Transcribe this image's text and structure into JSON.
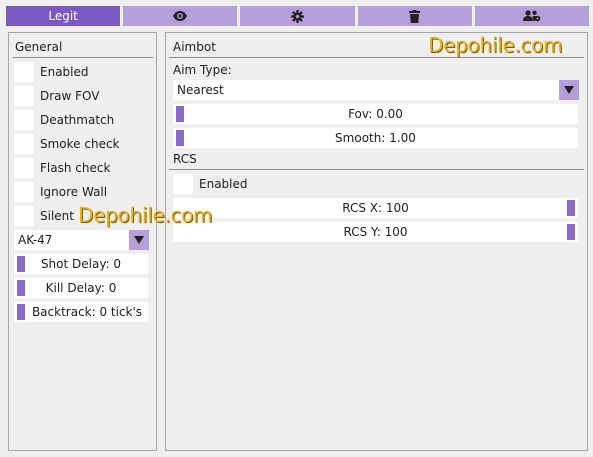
{
  "tabs": [
    {
      "label": "Legit",
      "icon": "",
      "active": true
    },
    {
      "label": "",
      "icon": "eye-icon",
      "active": false
    },
    {
      "label": "",
      "icon": "gear-icon",
      "active": false
    },
    {
      "label": "",
      "icon": "trash-icon",
      "active": false
    },
    {
      "label": "",
      "icon": "users-gear-icon",
      "active": false
    }
  ],
  "general": {
    "title": "General",
    "checkboxes": [
      "Enabled",
      "Draw FOV",
      "Deathmatch",
      "Smoke check",
      "Flash check",
      "Ignore Wall",
      "Silent"
    ],
    "weapon_select": "AK-47",
    "sliders": [
      {
        "label": "Shot Delay: 0",
        "fill": 0
      },
      {
        "label": "Kill Delay: 0",
        "fill": 0
      },
      {
        "label": "Backtrack: 0 tick's",
        "fill": 0
      }
    ]
  },
  "aimbot": {
    "title": "Aimbot",
    "aim_type_label": "Aim Type:",
    "aim_type_value": "Nearest",
    "fov_slider": {
      "label": "Fov: 0.00",
      "fill": 0
    },
    "smooth_slider": {
      "label": "Smooth: 1.00",
      "fill": 0
    }
  },
  "rcs": {
    "title": "RCS",
    "enabled_label": "Enabled",
    "x_slider": {
      "label": "RCS X: 100",
      "fill": 1
    },
    "y_slider": {
      "label": "RCS Y: 100",
      "fill": 1
    }
  },
  "watermarks": [
    "Depohile.com",
    "Depohile.com"
  ],
  "colors": {
    "accent": "#7a58c1",
    "accent_light": "#b49fd8",
    "slider_fill": "#8a6ac8",
    "background": "#efefef",
    "watermark": "#e6b52e"
  }
}
